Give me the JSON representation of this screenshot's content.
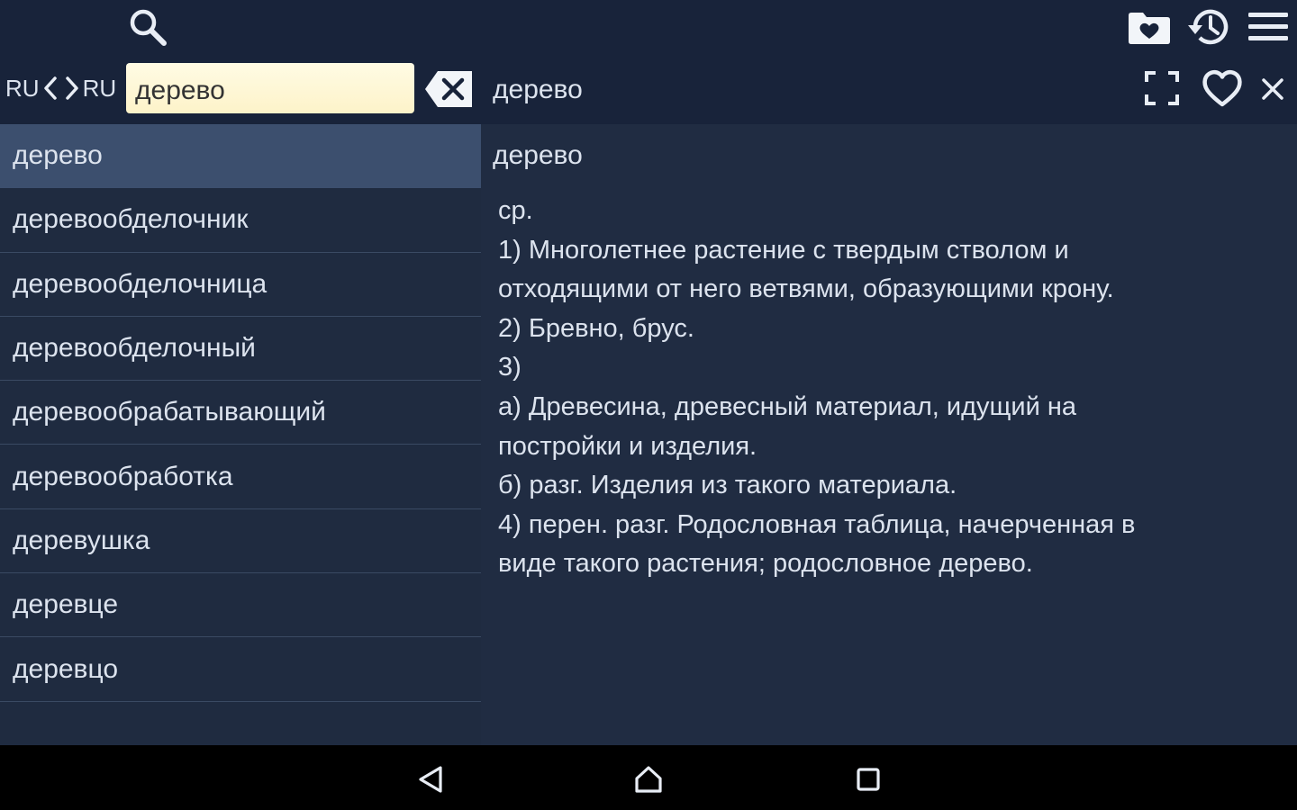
{
  "app": {
    "colors": {
      "header_bg": "#18233a",
      "content_bg": "#1f2b40",
      "selected_row": "#3c4f6e",
      "input_bg": "#fdf3c9",
      "text": "#dce3ee",
      "navbar_bg": "#000000"
    }
  },
  "header": {
    "icons": {
      "search": "search-icon",
      "favorites_folder": "folder-heart-icon",
      "history": "history-icon",
      "menu": "hamburger-menu-icon",
      "fullscreen": "fullscreen-icon",
      "favorite": "heart-outline-icon",
      "close": "close-icon",
      "clear": "backspace-clear-icon"
    },
    "lang_from": "RU",
    "lang_to": "RU",
    "search_value": "дерево",
    "current_word": "дерево"
  },
  "word_list": [
    "дерево",
    "деревообделочник",
    "деревообделочница",
    "деревообделочный",
    "деревообрабатывающий",
    "деревообработка",
    "деревушка",
    "деревце",
    "деревцо"
  ],
  "selected_index": 0,
  "article": {
    "title": "дерево",
    "lines": [
      "ср.",
      "1) Многолетнее растение с твердым стволом и",
      "отходящими от него ветвями, образующими крону.",
      "2) Бревно, брус.",
      "3)",
      "а) Древесина, древесный материал, идущий на",
      "постройки и изделия.",
      "б) разг. Изделия из такого материала.",
      "4) перен. разг. Родословная таблица, начерченная в",
      "виде такого растения; родословное дерево."
    ]
  },
  "navbar": {
    "icons": {
      "back": "back-triangle-icon",
      "home": "home-icon",
      "recents": "recents-square-icon"
    }
  }
}
